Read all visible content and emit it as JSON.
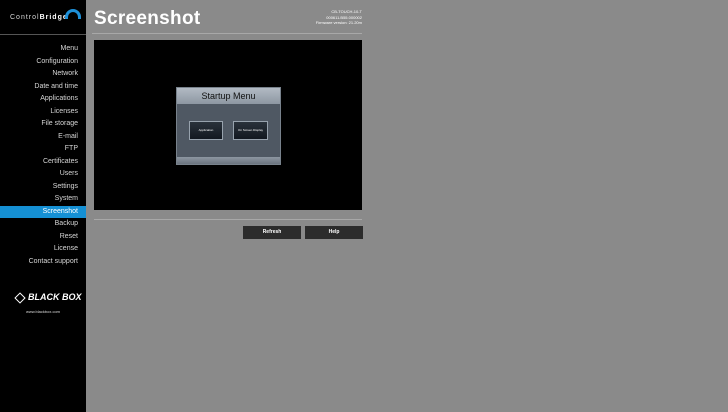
{
  "brand": {
    "name_part1": "Control",
    "name_part2": "Bridge"
  },
  "nav": {
    "items": [
      {
        "label": "Menu"
      },
      {
        "label": "Configuration"
      },
      {
        "label": "Network"
      },
      {
        "label": "Date and time"
      },
      {
        "label": "Applications"
      },
      {
        "label": "Licenses"
      },
      {
        "label": "File storage"
      },
      {
        "label": "E-mail"
      },
      {
        "label": "FTP"
      },
      {
        "label": "Certificates"
      },
      {
        "label": "Users"
      },
      {
        "label": "Settings"
      },
      {
        "label": "System"
      },
      {
        "label": "Screenshot",
        "active": true
      },
      {
        "label": "Backup"
      },
      {
        "label": "Reset"
      },
      {
        "label": "License"
      },
      {
        "label": "Contact support"
      }
    ]
  },
  "vendor": {
    "name": "BLACK BOX",
    "url": "www.blackbox.com"
  },
  "page": {
    "title": "Screenshot"
  },
  "device": {
    "model": "CB-TOUCH-10-T",
    "serial": "000611.B55.000002",
    "firmware": "Firmware version: 21.20m"
  },
  "screenshot": {
    "dialog_title": "Startup Menu",
    "button_application": "Application",
    "button_osd": "On Screen Display"
  },
  "actions": {
    "refresh": "Refresh",
    "help": "Help"
  },
  "colors": {
    "accent": "#1590d4",
    "sidebar_bg": "#000000",
    "page_bg": "#8a8a8a",
    "button_bg": "#2c2c2c"
  }
}
